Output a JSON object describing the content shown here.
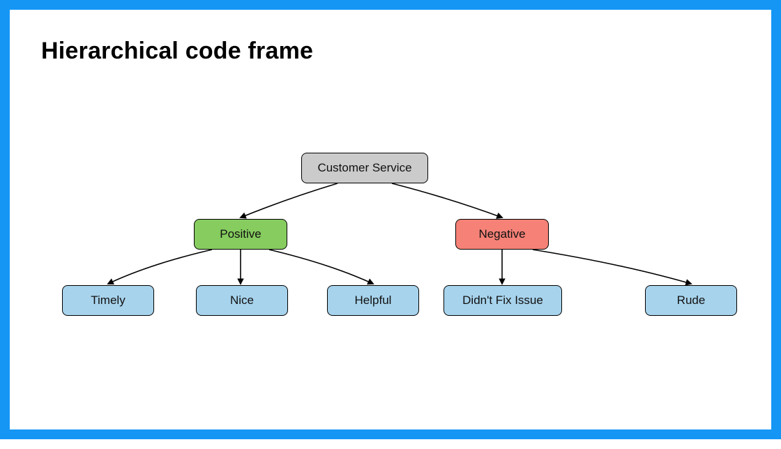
{
  "title": "Hierarchical code frame",
  "nodes": {
    "root": "Customer Service",
    "positive": "Positive",
    "negative": "Negative",
    "timely": "Timely",
    "nice": "Nice",
    "helpful": "Helpful",
    "didnt_fix": "Didn't Fix Issue",
    "rude": "Rude"
  },
  "colors": {
    "frame_border": "#1596F5",
    "root_bg": "#CBCBCB",
    "positive_bg": "#86CC5F",
    "negative_bg": "#F58177",
    "leaf_bg": "#A7D3EC"
  },
  "chart_data": {
    "type": "diagram",
    "title": "Hierarchical code frame",
    "root": "Customer Service",
    "children": [
      {
        "label": "Positive",
        "color": "#86CC5F",
        "children": [
          "Timely",
          "Nice",
          "Helpful"
        ]
      },
      {
        "label": "Negative",
        "color": "#F58177",
        "children": [
          "Didn't Fix Issue",
          "Rude"
        ]
      }
    ]
  }
}
